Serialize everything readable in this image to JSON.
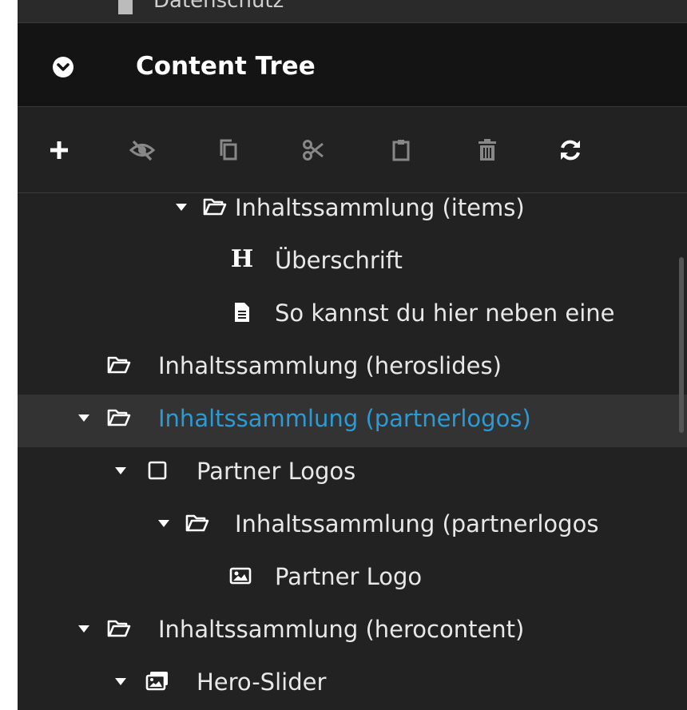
{
  "top_row": {
    "label": "Datenschutz"
  },
  "header": {
    "title": "Content Tree"
  },
  "toolbar": {
    "actions": [
      "add",
      "hide",
      "copy",
      "cut",
      "paste",
      "delete",
      "reload"
    ]
  },
  "tree": {
    "items": [
      {
        "label": "Inhaltssammlung (items)",
        "icon": "folder-open-icon",
        "expanded": true
      },
      {
        "label": "Überschrift",
        "icon": "heading-icon"
      },
      {
        "label": "So kannst du hier neben eine",
        "icon": "document-icon"
      },
      {
        "label": "Inhaltssammlung (heroslides)",
        "icon": "folder-open-icon"
      },
      {
        "label": "Inhaltssammlung (partnerlogos)",
        "icon": "folder-open-icon",
        "expanded": true,
        "selected": true
      },
      {
        "label": "Partner Logos",
        "icon": "square-icon",
        "expanded": true
      },
      {
        "label": "Inhaltssammlung (partnerlogos",
        "icon": "folder-open-icon",
        "expanded": true
      },
      {
        "label": "Partner Logo",
        "icon": "image-icon"
      },
      {
        "label": "Inhaltssammlung (herocontent)",
        "icon": "folder-open-icon",
        "expanded": true
      },
      {
        "label": "Hero-Slider",
        "icon": "images-icon",
        "expanded": true
      }
    ]
  },
  "colors": {
    "panel_bg": "#222222",
    "header_bg": "#141414",
    "selected_text": "#2b9bd6",
    "text": "#e8e8e8"
  }
}
